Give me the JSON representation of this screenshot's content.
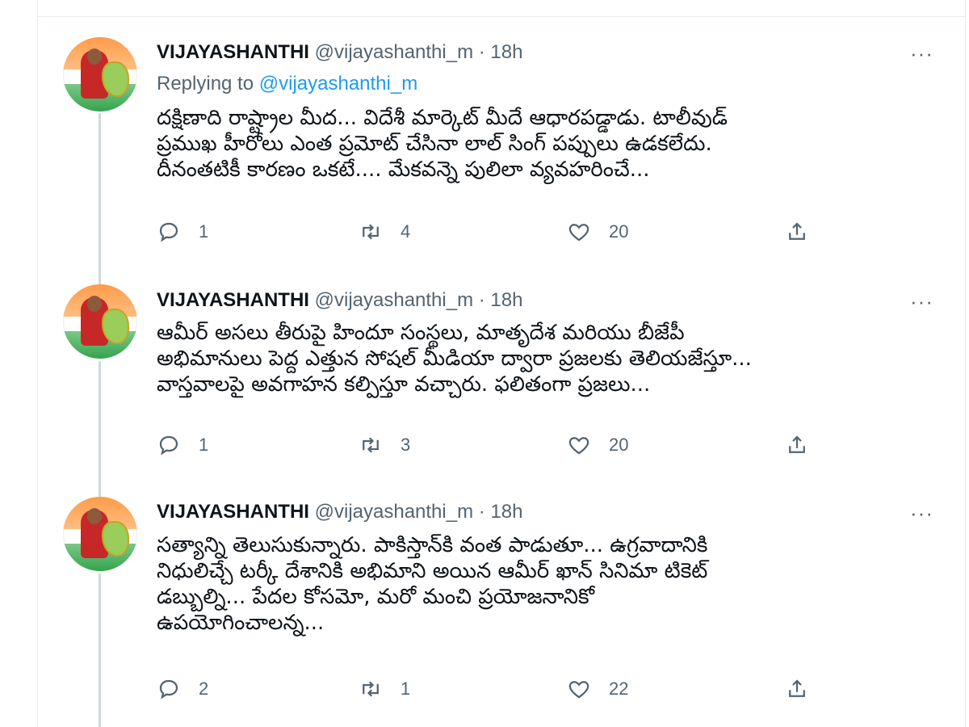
{
  "tweets": [
    {
      "name": "VIJAYASHANTHI",
      "handle": "@vijayashanthi_m",
      "time": "18h",
      "replying_label": "Replying to",
      "replying_handle": "@vijayashanthi_m",
      "text_lines": [
        "దక్షిణాది రాష్ట్రాల మీద... విదేశీ మార్కెట్ మీదే ఆధారపడ్డాడు. టాలీవుడ్",
        "ప్రముఖ హీరోలు ఎంత ప్రమోట్ చేసినా లాల్ సింగ్ పప్పులు ఉడకలేదు.",
        "దీనంతటికీ కారణం ఒకటే.... మేకవన్నె పులిలా వ్యవహరించే..."
      ],
      "replies": "1",
      "retweets": "4",
      "likes": "20"
    },
    {
      "name": "VIJAYASHANTHI",
      "handle": "@vijayashanthi_m",
      "time": "18h",
      "text_lines": [
        "ఆమీర్ అసలు తీరుపై హిందూ సంస్థలు, మాతృదేశ మరియు బీజేపీ",
        "అభిమానులు పెద్ద ఎత్తున సోషల్ మీడియా ద్వారా ప్రజలకు తెలియజేస్తూ...",
        "వాస్తవాలపై అవగాహన కల్పిస్తూ వచ్చారు. ఫలితంగా ప్రజలు..."
      ],
      "replies": "1",
      "retweets": "3",
      "likes": "20"
    },
    {
      "name": "VIJAYASHANTHI",
      "handle": "@vijayashanthi_m",
      "time": "18h",
      "text_lines": [
        "సత్యాన్ని తెలుసుకున్నారు. పాకిస్తాన్‌కి వంత పాడుతూ... ఉగ్రవాదానికి",
        "నిధులిచ్చే టర్కీ దేశానికి అభిమాని అయిన ఆమీర్ ఖాన్ సినిమా టికెట్",
        "డబ్బుల్ని... పేదల కోసమో, మరో మంచి ప్రయోజనానికో",
        "ఉపయోగించాలన్న..."
      ],
      "replies": "2",
      "retweets": "1",
      "likes": "22"
    }
  ],
  "icons": {
    "reply": "reply-icon",
    "retweet": "retweet-icon",
    "like": "like-icon",
    "share": "share-icon",
    "more": "more-icon"
  },
  "more_glyph": "···",
  "separator": " · ",
  "colors": {
    "text": "#0f1419",
    "muted": "#536471",
    "link": "#1d9bf0",
    "thread_line": "#cfd9de"
  }
}
